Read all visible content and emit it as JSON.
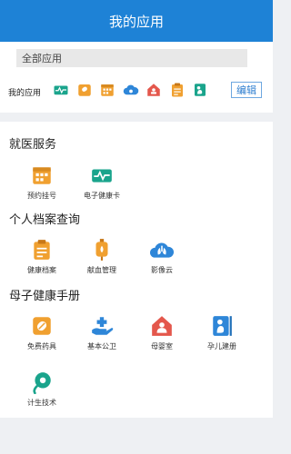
{
  "header": {
    "title": "我的应用"
  },
  "tabs": {
    "all_apps": "全部应用"
  },
  "my_apps": {
    "label": "我的应用",
    "edit": "编辑",
    "icons": [
      "health-card-icon",
      "medicine-icon",
      "appointment-icon",
      "cloud-icon",
      "mother-baby-icon",
      "health-record-icon",
      "pregnancy-icon"
    ]
  },
  "sections": [
    {
      "title": "就医服务",
      "apps": [
        {
          "label": "预约挂号",
          "icon": "appointment-icon"
        },
        {
          "label": "电子健康卡",
          "icon": "health-card-icon"
        }
      ]
    },
    {
      "title": "个人档案查询",
      "apps": [
        {
          "label": "健康档案",
          "icon": "health-record-icon"
        },
        {
          "label": "献血管理",
          "icon": "blood-donation-icon"
        },
        {
          "label": "影像云",
          "icon": "imaging-cloud-icon"
        }
      ]
    },
    {
      "title": "母子健康手册",
      "apps": [
        {
          "label": "免费药具",
          "icon": "free-medicine-icon"
        },
        {
          "label": "基本公卫",
          "icon": "public-health-icon"
        },
        {
          "label": "母婴室",
          "icon": "nursing-room-icon"
        },
        {
          "label": "孕儿建册",
          "icon": "pregnancy-registration-icon"
        },
        {
          "label": "计生技术",
          "icon": "family-planning-icon"
        }
      ]
    }
  ],
  "colors": {
    "header": "#1e82d6",
    "orange": "#f0a030",
    "green": "#1aa48c",
    "blue": "#2e86d8",
    "red": "#e4574c"
  }
}
